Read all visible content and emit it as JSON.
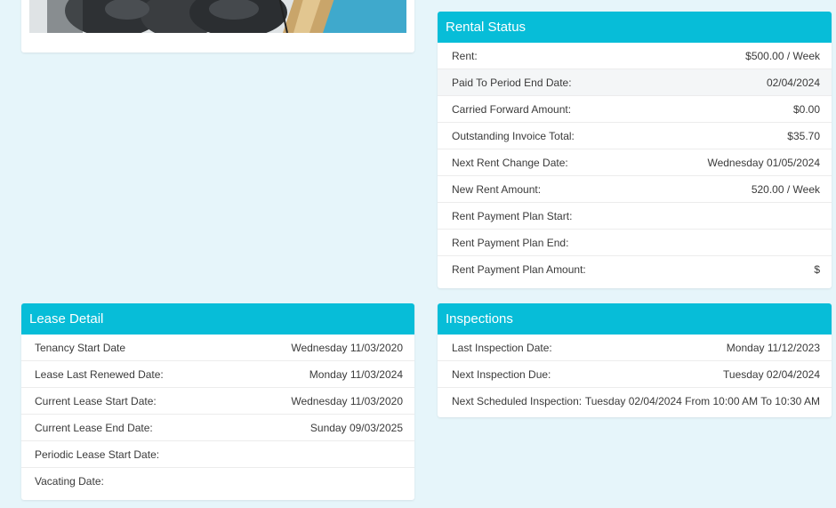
{
  "rental_status": {
    "title": "Rental Status",
    "rows": [
      {
        "label": "Rent:",
        "value": "$500.00 / Week"
      },
      {
        "label": "Paid To Period End Date:",
        "value": "02/04/2024"
      },
      {
        "label": "Carried Forward Amount:",
        "value": "$0.00"
      },
      {
        "label": "Outstanding Invoice Total:",
        "value": "$35.70"
      },
      {
        "label": "Next Rent Change Date:",
        "value": "Wednesday 01/05/2024"
      },
      {
        "label": "New Rent Amount:",
        "value": "520.00 / Week"
      },
      {
        "label": "Rent Payment Plan Start:",
        "value": ""
      },
      {
        "label": "Rent Payment Plan End:",
        "value": ""
      },
      {
        "label": "Rent Payment Plan Amount:",
        "value": "$"
      }
    ]
  },
  "lease_detail": {
    "title": "Lease Detail",
    "rows": [
      {
        "label": "Tenancy Start Date",
        "value": "Wednesday 11/03/2020"
      },
      {
        "label": "Lease Last Renewed Date:",
        "value": "Monday 11/03/2024"
      },
      {
        "label": "Current Lease Start Date:",
        "value": "Wednesday 11/03/2020"
      },
      {
        "label": "Current Lease End Date:",
        "value": "Sunday 09/03/2025"
      },
      {
        "label": "Periodic Lease Start Date:",
        "value": ""
      },
      {
        "label": "Vacating Date:",
        "value": ""
      }
    ]
  },
  "inspections": {
    "title": "Inspections",
    "rows": [
      {
        "label": "Last Inspection Date:",
        "value": "Monday 11/12/2023"
      },
      {
        "label": "Next Inspection Due:",
        "value": "Tuesday 02/04/2024"
      },
      {
        "label": "Next Scheduled Inspection:",
        "value": "Tuesday 02/04/2024 From 10:00 AM To 10:30 AM"
      }
    ]
  },
  "colors": {
    "header": "#07bdd8",
    "background": "#e6f5fa",
    "card": "#ffffff"
  }
}
